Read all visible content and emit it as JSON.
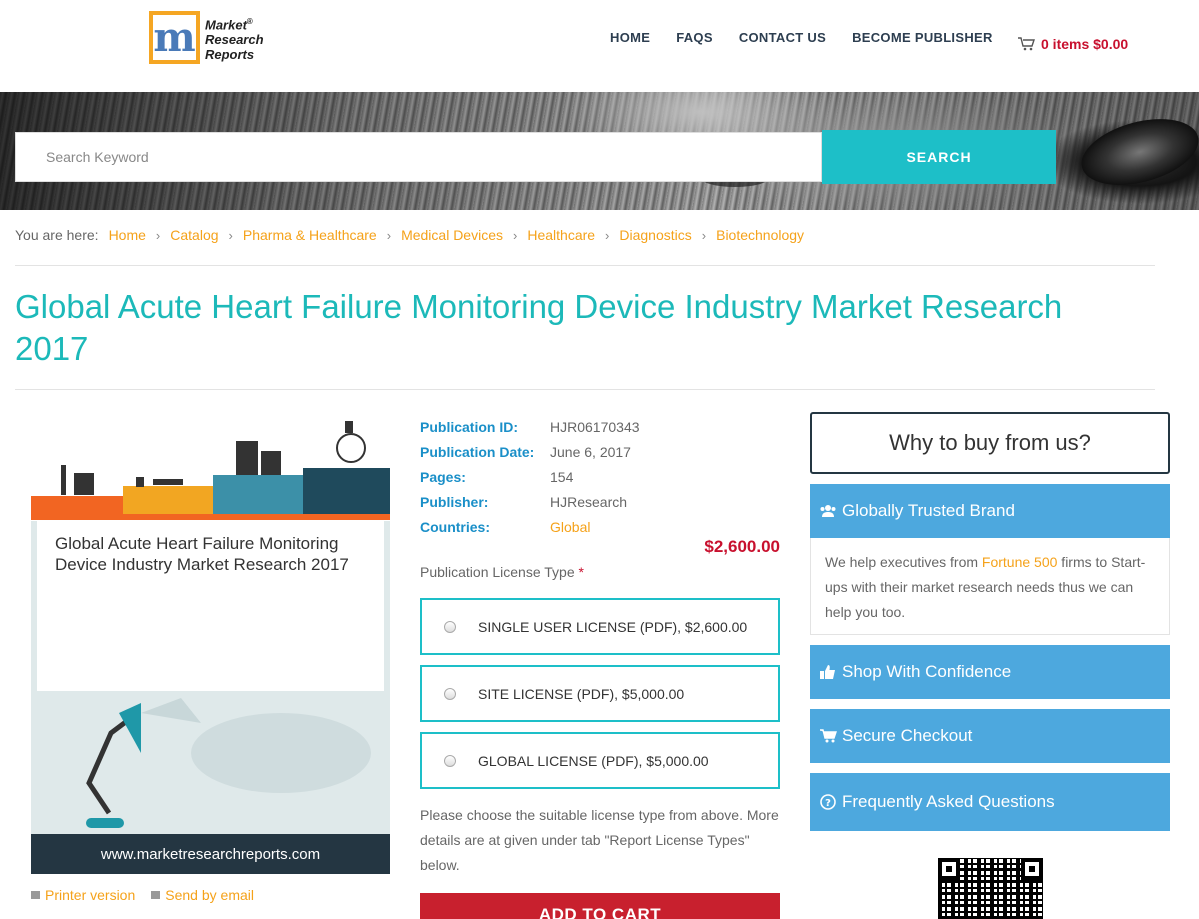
{
  "header": {
    "logo": {
      "line1": "Market",
      "line2": "Research",
      "line3": "Reports",
      "reg": "®"
    },
    "nav": [
      "HOME",
      "FAQS",
      "CONTACT US",
      "BECOME PUBLISHER"
    ],
    "cart": "0 items $0.00"
  },
  "search": {
    "placeholder": "Search Keyword",
    "button": "SEARCH"
  },
  "breadcrumb": {
    "label": "You are here:",
    "items": [
      "Home",
      "Catalog",
      "Pharma & Healthcare",
      "Medical Devices",
      "Healthcare",
      "Diagnostics",
      "Biotechnology"
    ]
  },
  "title": "Global Acute Heart Failure Monitoring Device Industry Market Research 2017",
  "cover": {
    "title": "Global Acute Heart Failure Monitoring Device Industry Market Research 2017",
    "url": "www.marketresearchreports.com"
  },
  "links": {
    "print": "Printer version",
    "email": "Send by email"
  },
  "meta": [
    {
      "k": "Publication ID:",
      "v": "HJR06170343"
    },
    {
      "k": "Publication Date:",
      "v": "June 6, 2017"
    },
    {
      "k": "Pages:",
      "v": "154"
    },
    {
      "k": "Publisher:",
      "v": "HJResearch"
    },
    {
      "k": "Countries:",
      "v": "Global"
    }
  ],
  "price": "$2,600.00",
  "license": {
    "label": "Publication License Type",
    "required": "*",
    "options": [
      "SINGLE USER LICENSE (PDF), $2,600.00",
      "SITE LICENSE (PDF), $5,000.00",
      "GLOBAL LICENSE (PDF), $5,000.00"
    ],
    "note": "Please choose the suitable license type from above. More details are at given under tab \"Report License Types\" below.",
    "add_to_cart": "ADD TO CART"
  },
  "sidebar": {
    "why": "Why to buy from us?",
    "trusted": "Globally Trusted Brand",
    "trusted_body_pre": "We help executives from ",
    "trusted_body_hl": "Fortune 500",
    "trusted_body_post": " firms to Start-ups with their market research needs thus we can help you too.",
    "shop": "Shop With Confidence",
    "secure": "Secure Checkout",
    "faq": "Frequently Asked Questions"
  },
  "colors": {
    "accent": "#1dbfc8",
    "link": "#f5a21a",
    "price": "#c8102e",
    "sidebar": "#4da8de"
  }
}
